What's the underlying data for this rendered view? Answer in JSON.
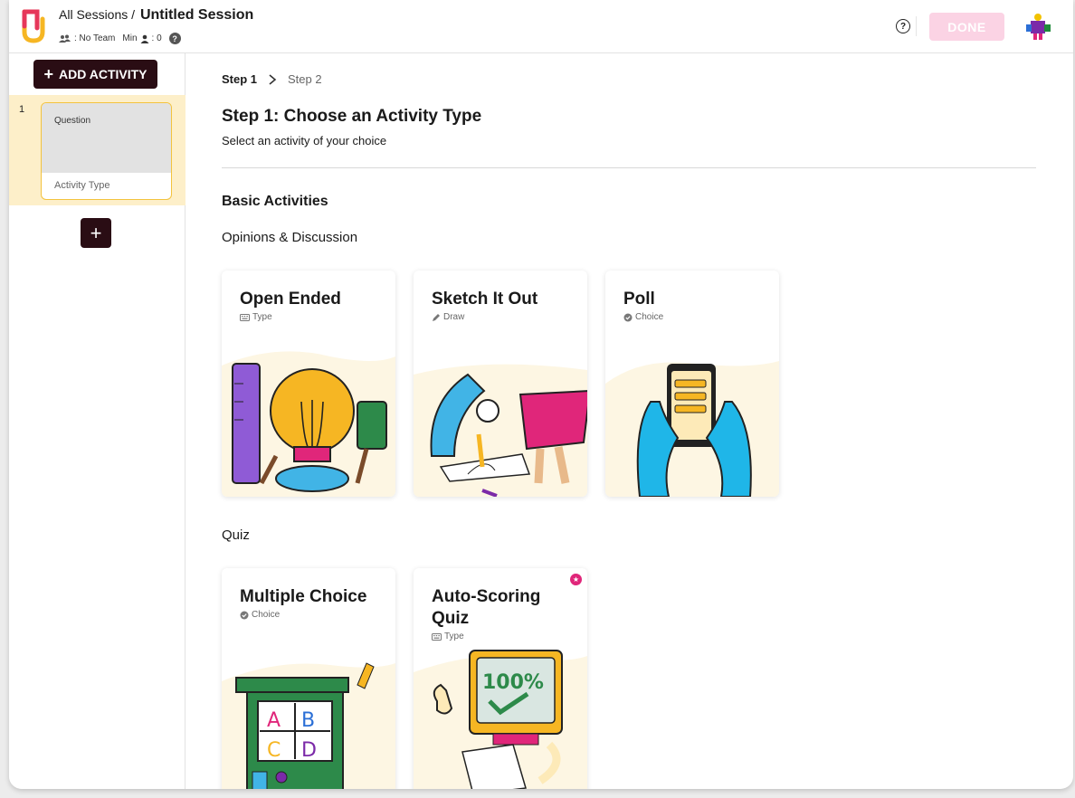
{
  "header": {
    "breadcrumb_root": "All Sessions /",
    "session_title": "Untitled Session",
    "team_label": ": No Team",
    "min_label": "Min",
    "min_value": ": 0",
    "help_glyph": "?",
    "meta_help_glyph": "?",
    "done_label": "DONE",
    "brand_colors": {
      "logo_red": "#e6375a",
      "logo_yellow": "#f6b623",
      "done_bg": "#fbd3e4"
    }
  },
  "sidebar": {
    "add_activity_label": "ADD ACTIVITY",
    "add_activity_icon": "+",
    "slides": [
      {
        "number": "1",
        "question": "Question",
        "type": "Activity Type"
      }
    ],
    "add_slide_icon": "+"
  },
  "main": {
    "steps": {
      "step1": "Step 1",
      "step2": "Step 2"
    },
    "title": "Step 1: Choose an Activity Type",
    "subtitle": "Select an activity of your choice",
    "section_title": "Basic Activities",
    "groups": [
      {
        "label": "Opinions & Discussion",
        "cards": [
          {
            "title": "Open Ended",
            "sub": "Type",
            "icon": "keyboard-icon"
          },
          {
            "title": "Sketch It Out",
            "sub": "Draw",
            "icon": "pencil-icon"
          },
          {
            "title": "Poll",
            "sub": "Choice",
            "icon": "check-circle-icon"
          }
        ]
      },
      {
        "label": "Quiz",
        "cards": [
          {
            "title": "Multiple Choice",
            "sub": "Choice",
            "icon": "check-circle-icon"
          },
          {
            "title": "Auto-Scoring Quiz",
            "sub": "Type",
            "icon": "keyboard-icon",
            "badge": "star-badge-icon"
          }
        ]
      }
    ]
  }
}
